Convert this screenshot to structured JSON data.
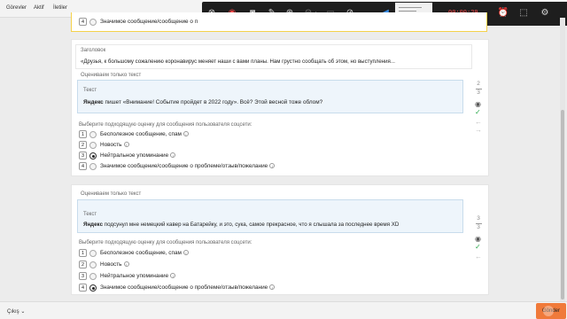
{
  "nav": {
    "items": [
      "Görevler",
      "Aktif",
      "İletiler"
    ]
  },
  "recorder": {
    "timer": "00:00:29",
    "zoom": "x1",
    "icons": [
      "close-icon",
      "record-icon",
      "screenshot-icon",
      "pen-icon",
      "zoom-in-icon",
      "zoom-out-icon",
      "fps-icon",
      "visibility-icon",
      "app-icon",
      "timer-icon",
      "alarm-icon",
      "save-icon",
      "settings-icon"
    ]
  },
  "card_prev": {
    "last_option": {
      "num": "4",
      "label": "Значимое сообщение/сообщение о п"
    }
  },
  "card2": {
    "heading_label": "Заголовок",
    "heading_text": "«Друзья, к большому сожалению коронавирус меняет наши с вами планы. Нам грустно сообщать об этом, но выступления...",
    "eval_label": "Оцениваем только текст",
    "quote_label": "Текст",
    "quote_brand": "Яндекс",
    "quote_text": " пишет «Внимание! Событие пройдет в 2022 году». Всё? Этой весной тоже облом?",
    "question": "Выберите подходящую оценку для сообщения пользователя соцсети:",
    "options": [
      {
        "num": "1",
        "label": "Бесполезное сообщение, спам",
        "selected": false
      },
      {
        "num": "2",
        "label": "Новость",
        "selected": false
      },
      {
        "num": "3",
        "label": "Нейтральное упоминание",
        "selected": true
      },
      {
        "num": "4",
        "label": "Значимое сообщение/сообщение о проблеме/отзыв/пожелание",
        "selected": false
      }
    ],
    "counter_current": "2",
    "counter_total": "3"
  },
  "card3": {
    "eval_label": "Оцениваем только текст",
    "quote_label": "Текст",
    "quote_brand": "Яндекс",
    "quote_text": " подсунул мне немецкий кавер на Батарейку, и это, сука, самое прекрасное, что я слышала за последнее время XD",
    "question": "Выберите подходящую оценку для сообщения пользователя соцсети:",
    "options": [
      {
        "num": "1",
        "label": "Бесполезное сообщение, спам",
        "selected": false
      },
      {
        "num": "2",
        "label": "Новость",
        "selected": false
      },
      {
        "num": "3",
        "label": "Нейтральное упоминание",
        "selected": false
      },
      {
        "num": "4",
        "label": "Значимое сообщение/сообщение о проблеме/отзыв/пожелание",
        "selected": true
      }
    ],
    "counter_current": "3",
    "counter_total": "3"
  },
  "bottom": {
    "exit_label": "Çıkış",
    "submit_label": "Gönder"
  },
  "colors": {
    "accent": "#f07a3a",
    "highlight": "#f5d24a",
    "quote_bg": "#eef5fb",
    "check": "#2aa84a"
  }
}
